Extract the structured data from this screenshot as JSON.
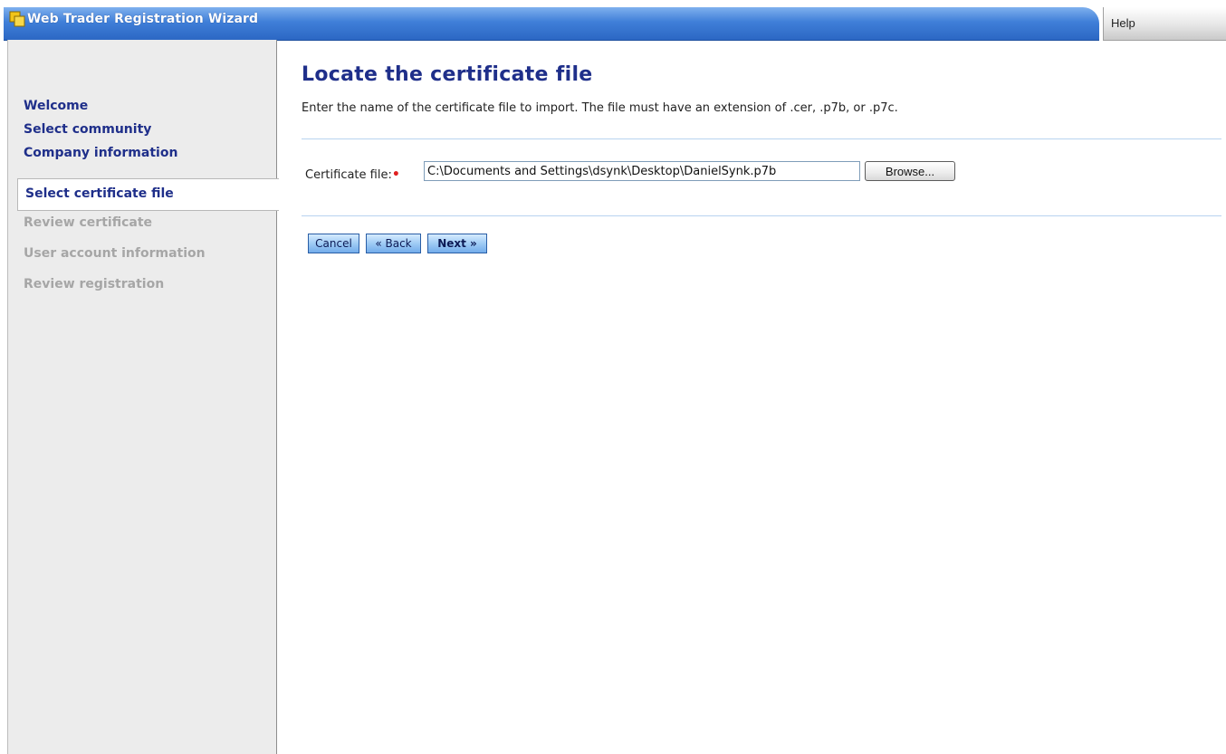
{
  "titlebar": {
    "title": "Web Trader Registration Wizard",
    "icon": "app-icon",
    "help_label": "Help"
  },
  "sidebar": {
    "completed_steps": [
      {
        "label": "Welcome"
      },
      {
        "label": "Select community"
      },
      {
        "label": "Company information"
      }
    ],
    "current_step": {
      "label": "Select certificate file"
    },
    "pending_steps": [
      {
        "label": "Review certificate"
      },
      {
        "label": "User account information"
      },
      {
        "label": "Review registration"
      }
    ]
  },
  "main": {
    "heading": "Locate the certificate file",
    "instructions": "Enter the name of the certificate file to import. The file must have an extension of .cer, .p7b, or .p7c.",
    "certificate_file": {
      "label": "Certificate file:",
      "required_marker": "•",
      "value": "C:\\Documents and Settings\\dsynk\\Desktop\\DanielSynk.p7b",
      "browse_label": "Browse..."
    },
    "buttons": {
      "cancel_label": "Cancel",
      "back_label": "« Back",
      "next_label": "Next »"
    }
  },
  "colors": {
    "titlebar_blue": "#3f7fd8",
    "heading_navy": "#1f2f8a",
    "pending_gray": "#a6a6a6",
    "sidebar_bg": "#ececec",
    "required_red": "#e02020"
  }
}
